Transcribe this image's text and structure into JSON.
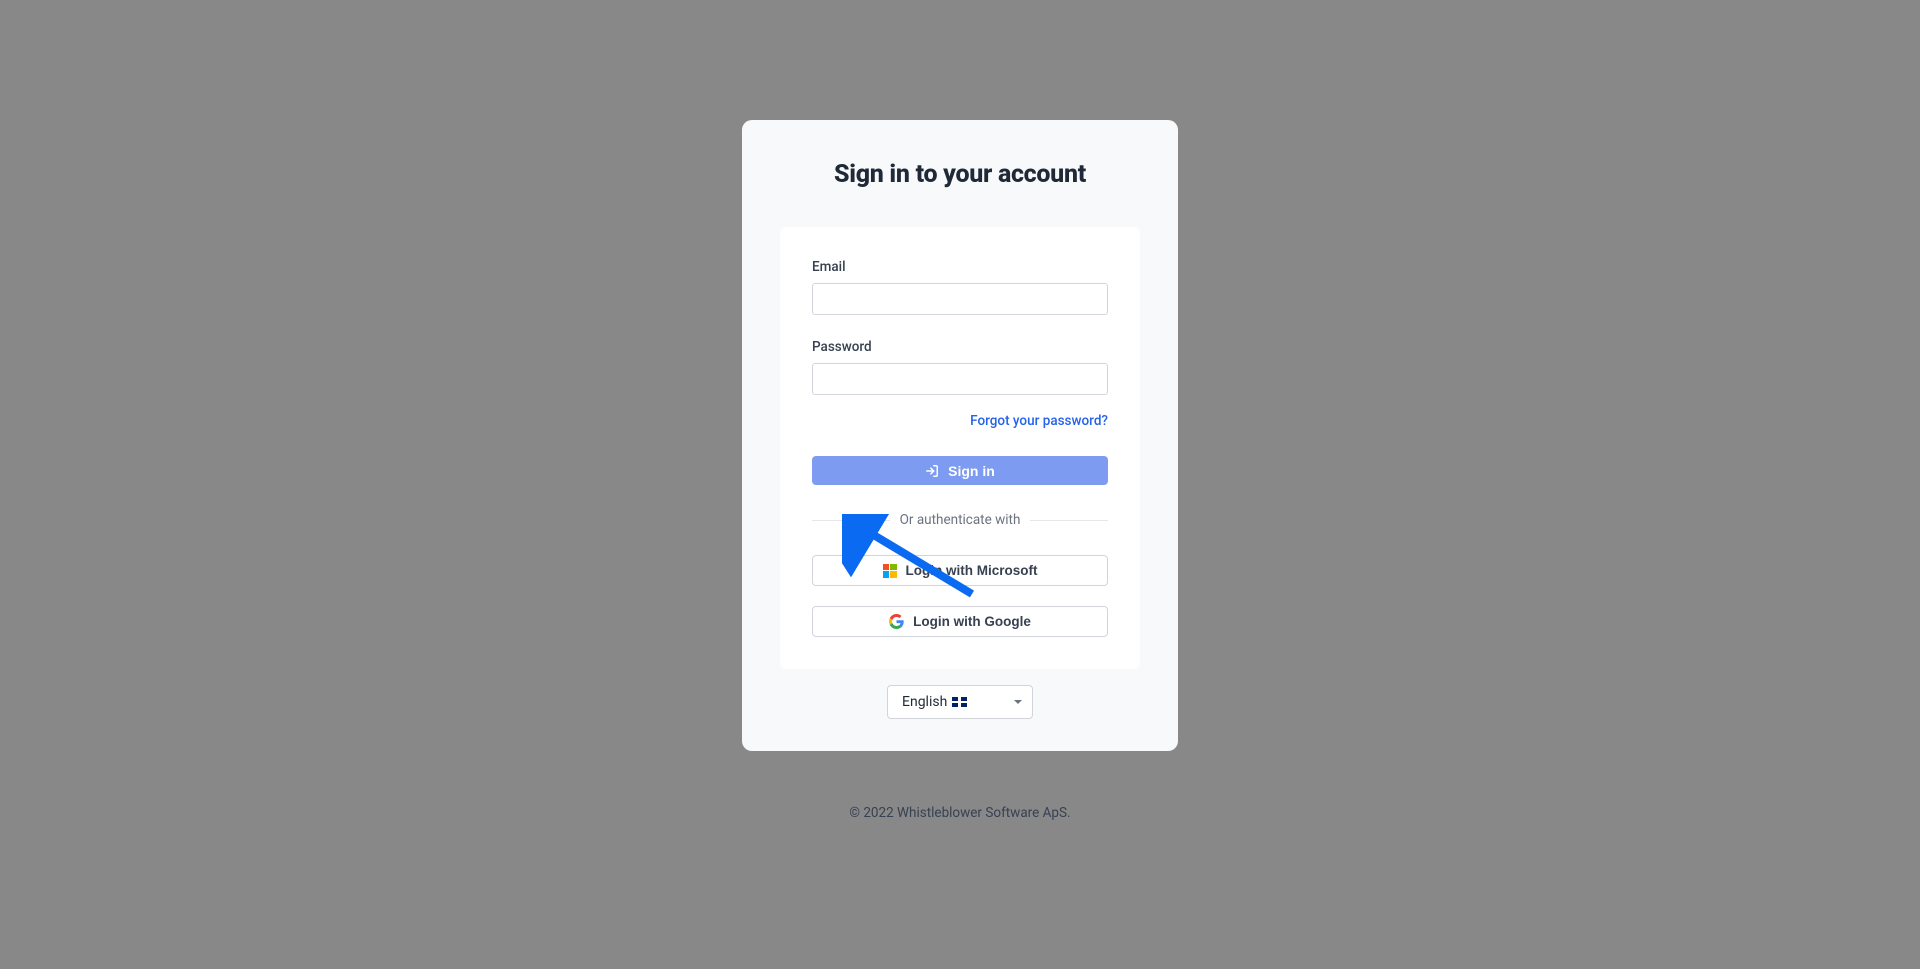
{
  "title": "Sign in to your account",
  "form": {
    "email_label": "Email",
    "email_value": "",
    "password_label": "Password",
    "password_value": "",
    "forgot_link": "Forgot your password?",
    "signin_label": "Sign in"
  },
  "divider": {
    "text": "Or authenticate with"
  },
  "sso": {
    "microsoft_label": "Login with Microsoft",
    "google_label": "Login with Google"
  },
  "language": {
    "selected": "English"
  },
  "footer": {
    "copyright": "© 2022 Whistleblower Software ApS."
  }
}
